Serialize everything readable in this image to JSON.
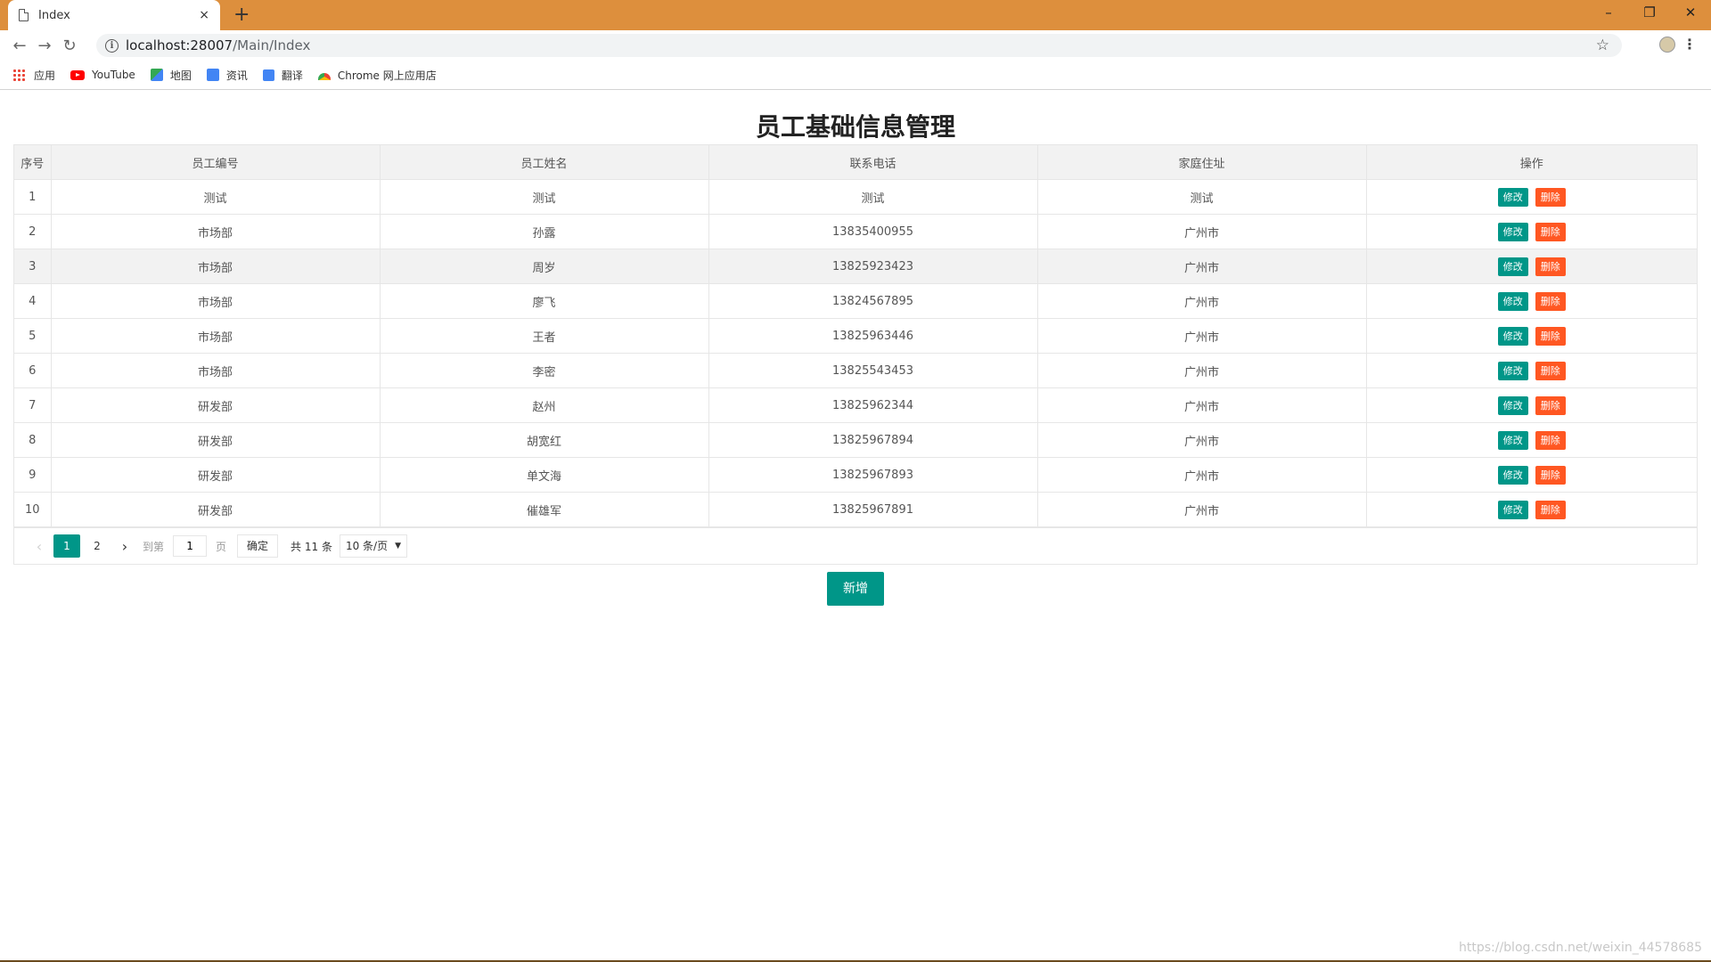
{
  "browser": {
    "tab_title": "Index",
    "tab_close": "×",
    "new_tab": "+",
    "window_controls": {
      "minimize": "–",
      "restore": "❐",
      "close": "✕"
    },
    "url_host": "localhost:28007",
    "url_path": "/Main/Index",
    "bookmarks": [
      "应用",
      "YouTube",
      "地图",
      "资讯",
      "翻译",
      "Chrome 网上应用店"
    ]
  },
  "page": {
    "title": "员工基础信息管理",
    "add_button": "新增",
    "watermark": "https://blog.csdn.net/weixin_44578685"
  },
  "table": {
    "headers": [
      "序号",
      "员工编号",
      "员工姓名",
      "联系电话",
      "家庭住址",
      "操作"
    ],
    "edit_label": "修改",
    "delete_label": "删除",
    "rows": [
      [
        "1",
        "测试",
        "测试",
        "测试",
        "测试"
      ],
      [
        "2",
        "市场部",
        "孙露",
        "13835400955",
        "广州市"
      ],
      [
        "3",
        "市场部",
        "周岁",
        "13825923423",
        "广州市"
      ],
      [
        "4",
        "市场部",
        "廖飞",
        "13824567895",
        "广州市"
      ],
      [
        "5",
        "市场部",
        "王者",
        "13825963446",
        "广州市"
      ],
      [
        "6",
        "市场部",
        "李密",
        "13825543453",
        "广州市"
      ],
      [
        "7",
        "研发部",
        "赵州",
        "13825962344",
        "广州市"
      ],
      [
        "8",
        "研发部",
        "胡宽红",
        "13825967894",
        "广州市"
      ],
      [
        "9",
        "研发部",
        "单文海",
        "13825967893",
        "广州市"
      ],
      [
        "10",
        "研发部",
        "催雄军",
        "13825967891",
        "广州市"
      ]
    ]
  },
  "pager": {
    "pages": [
      "1",
      "2"
    ],
    "current": "1",
    "goto_label": "到第",
    "goto_value": "1",
    "page_unit": "页",
    "confirm": "确定",
    "total": "共 11 条",
    "page_size": "10 条/页"
  },
  "colors": {
    "primary": "#009688",
    "danger": "#ff5722",
    "titlebar": "#dd8f3d"
  }
}
